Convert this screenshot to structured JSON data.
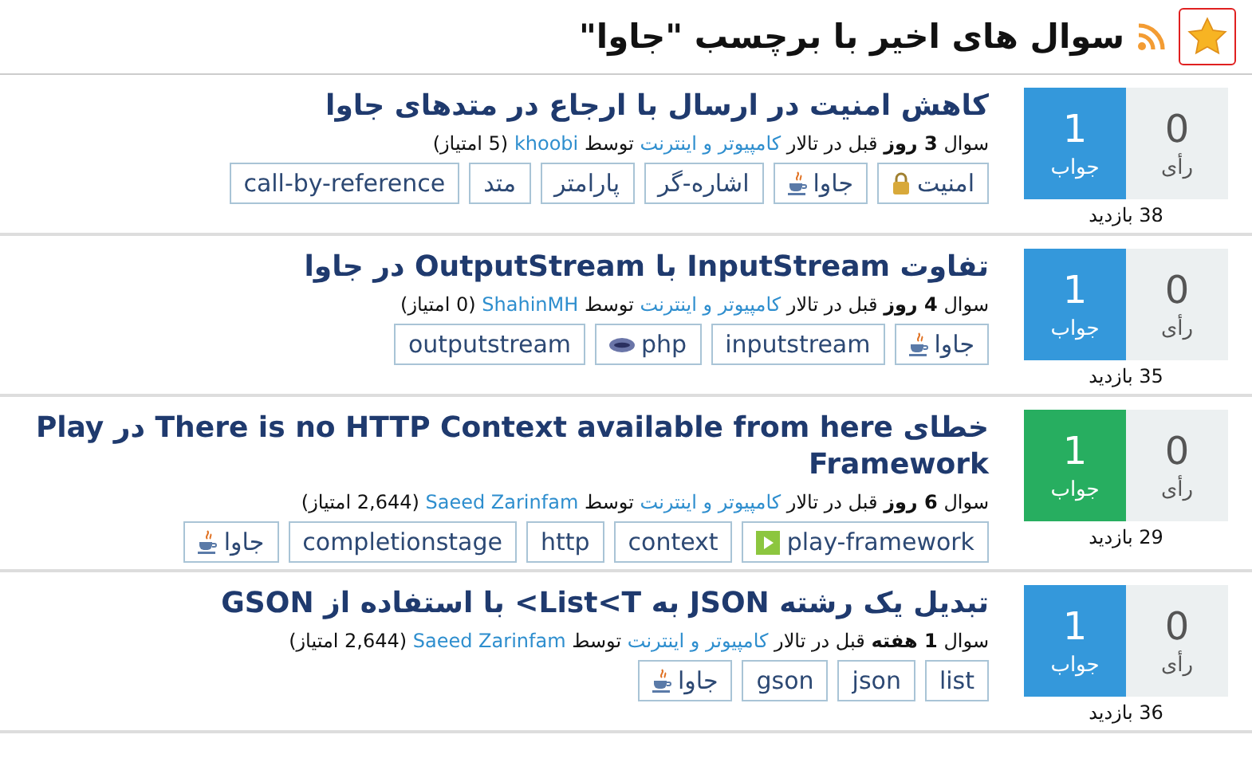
{
  "header": {
    "title": "سوال های اخیر با برچسب \"جاوا\"",
    "favorite": true
  },
  "questions": [
    {
      "title": "کاهش امنیت در ارسال با ارجاع در متدهای جاوا",
      "votes": "0",
      "votes_label": "رأی",
      "answers": "1",
      "answers_label": "جواب",
      "accepted": false,
      "views": "38 بازدید",
      "asked": "سوال **3 روز** قبل در تالار",
      "category": "کامپیوتر و اینترنت",
      "by": "توسط",
      "user": "khoobi",
      "points": "(5 امتیاز)",
      "tags": [
        {
          "label": "امنیت",
          "kind": "lock"
        },
        {
          "label": "جاوا",
          "kind": "java"
        },
        {
          "label": "اشاره-گر",
          "kind": "plain"
        },
        {
          "label": "پارامتر",
          "kind": "plain"
        },
        {
          "label": "متد",
          "kind": "plain"
        },
        {
          "label": "call-by-reference",
          "kind": "plain"
        }
      ]
    },
    {
      "title": "تفاوت InputStream با OutputStream در جاوا",
      "votes": "0",
      "votes_label": "رأی",
      "answers": "1",
      "answers_label": "جواب",
      "accepted": false,
      "views": "35 بازدید",
      "asked": "سوال **4 روز** قبل در تالار",
      "category": "کامپیوتر و اینترنت",
      "by": "توسط",
      "user": "ShahinMH",
      "points": "(0 امتیاز)",
      "tags": [
        {
          "label": "جاوا",
          "kind": "java"
        },
        {
          "label": "inputstream",
          "kind": "plain"
        },
        {
          "label": "php",
          "kind": "php"
        },
        {
          "label": "outputstream",
          "kind": "plain"
        }
      ]
    },
    {
      "title": "خطای There is no HTTP Context available from here در Play Framework",
      "votes": "0",
      "votes_label": "رأی",
      "answers": "1",
      "answers_label": "جواب",
      "accepted": true,
      "views": "29 بازدید",
      "asked": "سوال **6 روز** قبل در تالار",
      "category": "کامپیوتر و اینترنت",
      "by": "توسط",
      "user": "Saeed Zarinfam",
      "points": "(2,644 امتیاز)",
      "tags": [
        {
          "label": "play-framework",
          "kind": "play"
        },
        {
          "label": "context",
          "kind": "plain"
        },
        {
          "label": "http",
          "kind": "plain"
        },
        {
          "label": "completionstage",
          "kind": "plain"
        },
        {
          "label": "جاوا",
          "kind": "java"
        }
      ]
    },
    {
      "title": "تبدیل یک رشته JSON به List<T> با استفاده از GSON",
      "votes": "0",
      "votes_label": "رأی",
      "answers": "1",
      "answers_label": "جواب",
      "accepted": false,
      "views": "36 بازدید",
      "asked": "سوال **1 هفته** قبل در تالار",
      "category": "کامپیوتر و اینترنت",
      "by": "توسط",
      "user": "Saeed Zarinfam",
      "points": "(2,644 امتیاز)",
      "tags": [
        {
          "label": "list",
          "kind": "plain"
        },
        {
          "label": "json",
          "kind": "plain"
        },
        {
          "label": "gson",
          "kind": "plain"
        },
        {
          "label": "جاوا",
          "kind": "java"
        }
      ]
    }
  ]
}
